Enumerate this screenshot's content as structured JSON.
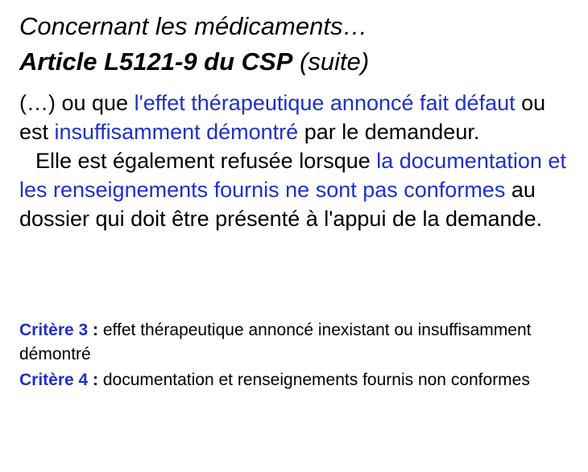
{
  "title": {
    "line1": "Concernant les médicaments…",
    "line2_bold": "Article L5121-9 du CSP",
    "line2_rest": " (suite)"
  },
  "body": {
    "para1": [
      {
        "text": "(…) ou que ",
        "highlight": false
      },
      {
        "text": "l'effet thérapeutique annoncé fait défaut",
        "highlight": true
      },
      {
        "text": " ou est ",
        "highlight": false
      },
      {
        "text": "insuffisamment démontré",
        "highlight": true
      },
      {
        "text": " par le demandeur.",
        "highlight": false
      }
    ],
    "para2": [
      {
        "text": "Elle est également refusée lorsque ",
        "highlight": false
      },
      {
        "text": "la documentation et les renseignements fournis ne sont pas conformes",
        "highlight": true
      },
      {
        "text": " au dossier qui doit être présenté à l'appui de la demande.",
        "highlight": false
      }
    ]
  },
  "criteria": [
    {
      "label": "Critère 3",
      "colon": " :",
      "text": " effet thérapeutique annoncé inexistant ou insuffisamment démontré"
    },
    {
      "label": "Critère 4",
      "colon": " :",
      "text": " documentation et renseignements fournis non conformes"
    }
  ],
  "colors": {
    "highlight": "#1f2fd0",
    "text": "#000000",
    "background": "#ffffff"
  }
}
